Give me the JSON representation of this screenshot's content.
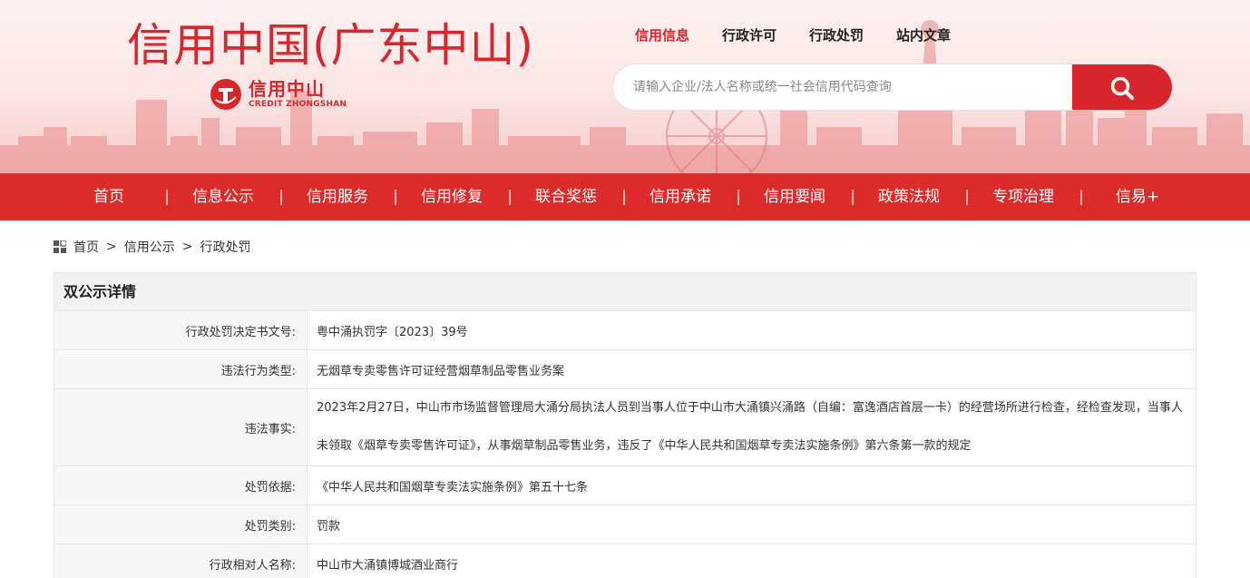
{
  "header": {
    "site_title": "信用中国(广东中山)",
    "logo_cn": "信用中山",
    "logo_en": "CREDIT ZHONGSHAN",
    "top_links": [
      {
        "label": "信用信息",
        "active": true
      },
      {
        "label": "行政许可",
        "active": false
      },
      {
        "label": "行政处罚",
        "active": false
      },
      {
        "label": "站内文章",
        "active": false
      }
    ],
    "search_placeholder": "请输入企业/法人名称或统一社会信用代码查询",
    "search_icon": "search-icon"
  },
  "nav": {
    "items": [
      "首页",
      "信息公示",
      "信用服务",
      "信用修复",
      "联合奖惩",
      "信用承诺",
      "信用要闻",
      "政策法规",
      "专项治理",
      "信易+"
    ]
  },
  "breadcrumb": {
    "icon": "grid-icon",
    "items": [
      "首页",
      "信用公示",
      "行政处罚"
    ],
    "separator": ">"
  },
  "detail": {
    "title": "双公示详情",
    "rows": [
      {
        "label": "行政处罚决定书文号:",
        "value": "粤中涌执罚字〔2023〕39号"
      },
      {
        "label": "违法行为类型:",
        "value": "无烟草专卖零售许可证经营烟草制品零售业务案"
      },
      {
        "label": "违法事实:",
        "value": "2023年2月27日，中山市市场监督管理局大涌分局执法人员到当事人位于中山市大涌镇兴涌路（自编：富逸酒店首层一卡）的经营场所进行检查，经检查发现，当事人未领取《烟草专卖零售许可证》，从事烟草制品零售业务，违反了《中华人民共和国烟草专卖法实施条例》第六条第一款的规定"
      },
      {
        "label": "处罚依据:",
        "value": "《中华人民共和国烟草专卖法实施条例》第五十七条"
      },
      {
        "label": "处罚类别:",
        "value": "罚款"
      },
      {
        "label": "行政相对人名称:",
        "value": "中山市大涌镇博城酒业商行"
      }
    ]
  },
  "colors": {
    "brand_red": "#d7272c",
    "nav_red": "#dd2a2b"
  }
}
